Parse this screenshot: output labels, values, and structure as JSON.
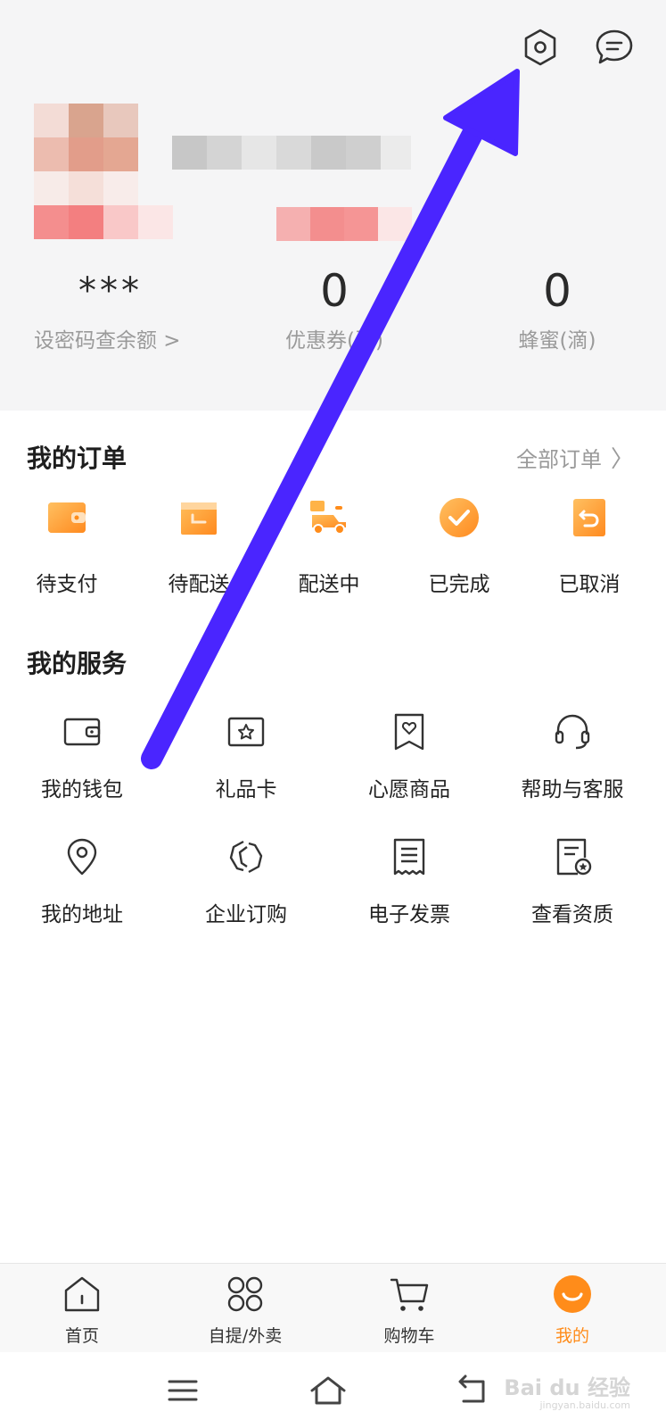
{
  "colors": {
    "accent": "#ff8c1a",
    "accent_light": "#ffb347",
    "arrow": "#4a25ff",
    "header_bg": "#f5f5f6"
  },
  "header": {
    "settings_icon": "hexagon-settings-icon",
    "message_icon": "chat-message-icon",
    "stats": [
      {
        "value": "***",
        "label": "设密码查余额 >"
      },
      {
        "value": "0",
        "label": "优惠券(张)"
      },
      {
        "value": "0",
        "label": "蜂蜜(滴)"
      }
    ]
  },
  "orders": {
    "title": "我的订单",
    "all_label": "全部订单",
    "items": [
      {
        "label": "待支付",
        "icon": "wallet-icon"
      },
      {
        "label": "待配送",
        "icon": "box-icon"
      },
      {
        "label": "配送中",
        "icon": "scooter-icon"
      },
      {
        "label": "已完成",
        "icon": "check-circle-icon"
      },
      {
        "label": "已取消",
        "icon": "undo-receipt-icon"
      }
    ]
  },
  "services": {
    "title": "我的服务",
    "items": [
      {
        "label": "我的钱包",
        "icon": "wallet-outline-icon"
      },
      {
        "label": "礼品卡",
        "icon": "gift-card-icon"
      },
      {
        "label": "心愿商品",
        "icon": "heart-bookmark-icon"
      },
      {
        "label": "帮助与客服",
        "icon": "headset-icon"
      },
      {
        "label": "我的地址",
        "icon": "location-pin-icon"
      },
      {
        "label": "企业订购",
        "icon": "hexagon-link-icon"
      },
      {
        "label": "电子发票",
        "icon": "receipt-icon"
      },
      {
        "label": "查看资质",
        "icon": "certificate-icon"
      }
    ]
  },
  "tabbar": {
    "items": [
      {
        "label": "首页",
        "icon": "home-icon"
      },
      {
        "label": "自提/外卖",
        "icon": "grid-icon"
      },
      {
        "label": "购物车",
        "icon": "cart-icon"
      },
      {
        "label": "我的",
        "icon": "smile-face-icon",
        "active": true
      }
    ]
  },
  "watermark": {
    "text": "Bai du 经验",
    "sub": "jingyan.baidu.com"
  }
}
